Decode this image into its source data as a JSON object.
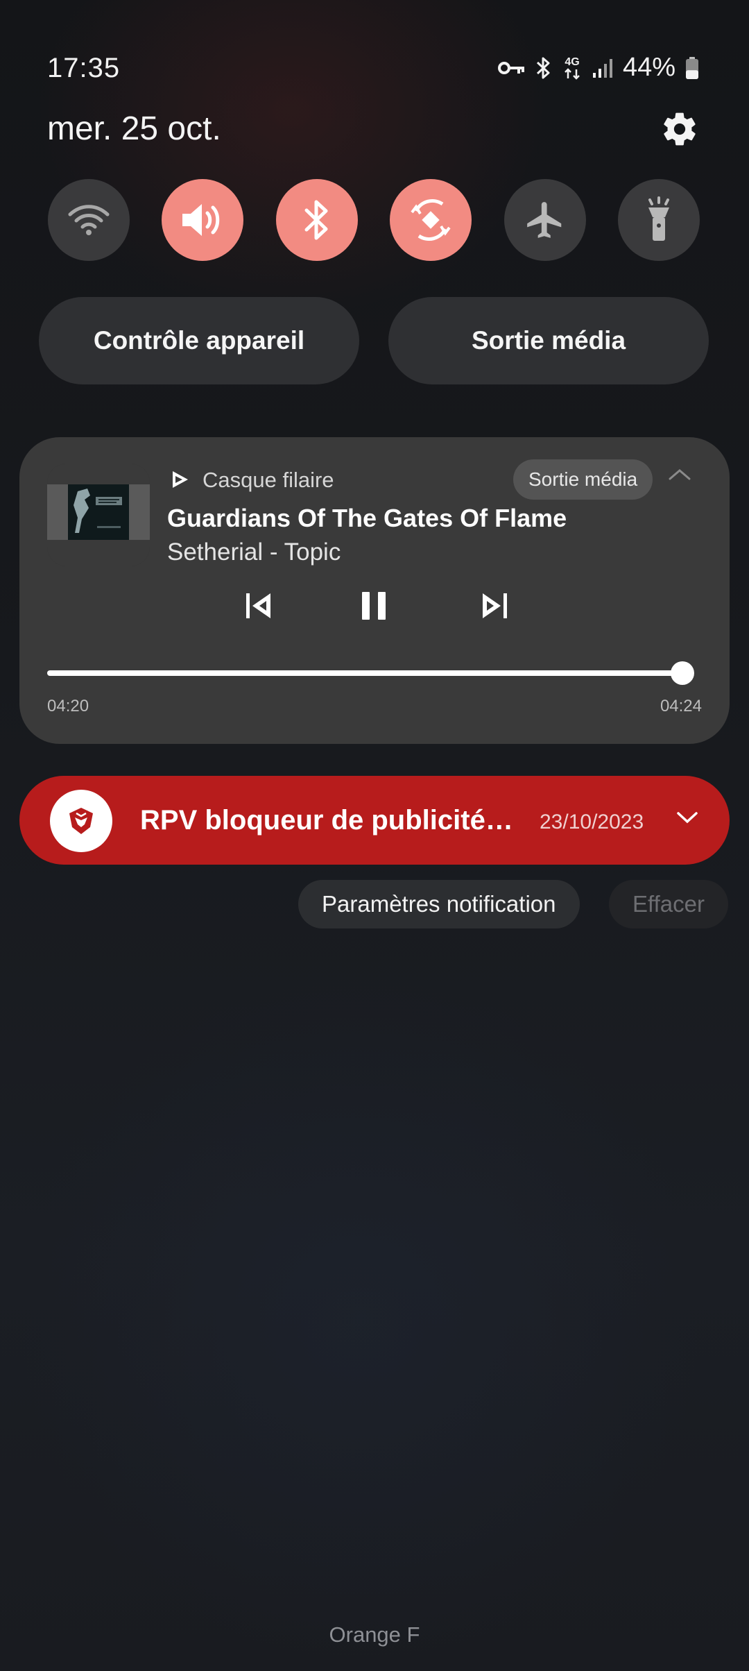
{
  "status_bar": {
    "time": "17:35",
    "network_type": "4G",
    "battery_percent": "44%",
    "battery_level": 0.44,
    "icons": [
      "vpn-key-icon",
      "bluetooth-icon",
      "4g-data-icon",
      "signal-icon",
      "battery-icon"
    ]
  },
  "header": {
    "date": "mer. 25 oct."
  },
  "quick_toggles": [
    {
      "icon": "wifi-icon",
      "on": false
    },
    {
      "icon": "sound-icon",
      "on": true
    },
    {
      "icon": "bluetooth-icon",
      "on": true
    },
    {
      "icon": "auto-rotate-icon",
      "on": true
    },
    {
      "icon": "airplane-mode-icon",
      "on": false
    },
    {
      "icon": "flashlight-icon",
      "on": false
    }
  ],
  "pills": {
    "device_control": "Contrôle appareil",
    "media_output": "Sortie média"
  },
  "media": {
    "device": "Casque filaire",
    "output_chip": "Sortie média",
    "title": "Guardians Of The Gates Of Flame",
    "artist": "Setherial - Topic",
    "elapsed": "04:20",
    "duration": "04:24",
    "progress": 0.985
  },
  "notification": {
    "title": "RPV bloqueur de publicités et de",
    "date": "23/10/2023",
    "accent": "#b71c1c"
  },
  "actions": {
    "notification_settings": "Paramètres notification",
    "clear": "Effacer"
  },
  "carrier": "Orange F",
  "colors": {
    "toggle_on": "#f28b82",
    "toggle_off": "#3a3a3c",
    "card": "#3a3a3a"
  }
}
